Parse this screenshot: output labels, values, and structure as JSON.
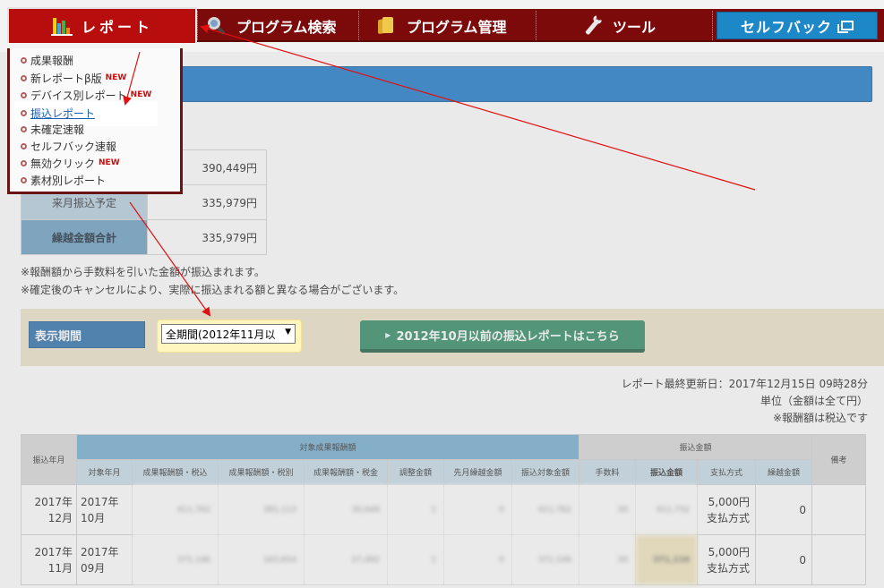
{
  "nav": {
    "report": "レポート",
    "program_search": "プログラム検索",
    "program_manage": "プログラム管理",
    "tools": "ツール",
    "selfback": "セルフバック"
  },
  "menu": {
    "items": [
      {
        "label": "成果報酬",
        "new": ""
      },
      {
        "label": "新レポートβ版",
        "new": "NEW"
      },
      {
        "label": "デバイス別レポート",
        "new": "NEW"
      },
      {
        "label": "振込レポート",
        "new": ""
      },
      {
        "label": "未確定速報",
        "new": ""
      },
      {
        "label": "セルフバック速報",
        "new": ""
      },
      {
        "label": "無効クリック",
        "new": "NEW"
      },
      {
        "label": "素材別レポート",
        "new": ""
      }
    ]
  },
  "summary": {
    "rows": [
      {
        "label": "",
        "value": "390,449円"
      },
      {
        "label": "来月振込予定",
        "value": "335,979円"
      },
      {
        "label": "繰越金額合計",
        "value": "335,979円"
      }
    ]
  },
  "notes": [
    "※報酬額から手数料を引いた金額が振込まれます。",
    "※確定後のキャンセルにより、実際に振込まれる額と異なる場合がございます。"
  ],
  "period": {
    "label": "表示期間",
    "selected": "全期間(2012年11月以",
    "old_report_button": "2012年10月以前の振込レポートはこちら"
  },
  "meta": {
    "updated": "レポート最終更新日：2017年12月15日 09時28分",
    "unit": "単位（金額は全て円）",
    "tax": "※報酬額は税込です"
  },
  "table": {
    "h_transfer_month": "振込年月",
    "h_group_reward": "対象成果報酬額",
    "h_group_transfer": "振込金額",
    "h_note": "備考",
    "sub": {
      "target_month": "対象年月",
      "reward_incl": "成果報酬額・税込",
      "reward_excl": "成果報酬額・税別",
      "reward_tax": "成果報酬額・税金",
      "adjust": "調整金額",
      "carry_prev": "先月繰越金額",
      "transfer_target": "振込対象金額",
      "fee": "手数料",
      "transfer_amount": "振込金額",
      "pay_method": "支払方式",
      "carry_amount": "繰越金額"
    },
    "rows": [
      {
        "y": "2017年",
        "m": "12月",
        "ty": "2017年",
        "tm": "10月",
        "reward_incl": "411,762",
        "reward_excl": "381,113",
        "reward_tax": "30,649",
        "adjust": "1",
        "carry_prev": "0",
        "transfer_target": "411,762",
        "fee": "30",
        "transfer_amount": "411,732",
        "pay1": "5,000円",
        "pay2": "支払方式",
        "carry": "0"
      },
      {
        "y": "2017年",
        "m": "11月",
        "ty": "2017年",
        "tm": "09月",
        "reward_incl": "371,146",
        "reward_excl": "343,654",
        "reward_tax": "27,492",
        "adjust": "1",
        "carry_prev": "0",
        "transfer_target": "371,146",
        "fee": "30",
        "transfer_amount": "371,116",
        "pay1": "5,000円",
        "pay2": "支払方式",
        "carry": "0"
      }
    ]
  },
  "colors": {
    "nav_bg": "#7c0a0a",
    "nav_active": "#b80d0d",
    "selfback": "#1d88c8",
    "arrow": "#e01010"
  }
}
